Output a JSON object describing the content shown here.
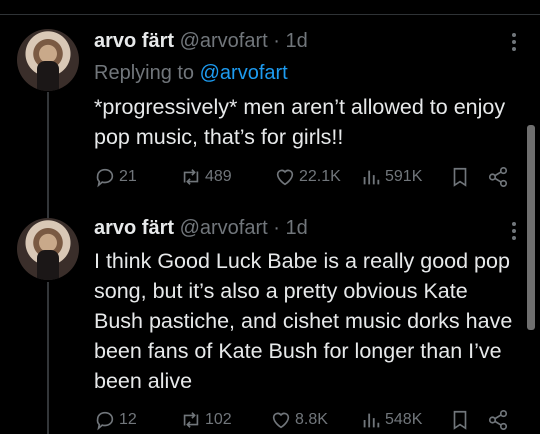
{
  "tweets": [
    {
      "author_name": "arvo färt",
      "handle": "@arvofart",
      "separator": "·",
      "time": "1d",
      "replying_prefix": "Replying to ",
      "replying_to": "@arvofart",
      "text": "*progressively* men aren’t allowed to enjoy pop music, that’s for girls!!",
      "replies": "21",
      "reposts": "489",
      "likes": "22.1K",
      "views": "591K"
    },
    {
      "author_name": "arvo färt",
      "handle": "@arvofart",
      "separator": "·",
      "time": "1d",
      "text": "I think Good Luck Babe is a really good pop song, but it’s also a pretty obvious Kate Bush pastiche, and cishet music dorks have been fans of Kate Bush for longer than I’ve been alive",
      "replies": "12",
      "reposts": "102",
      "likes": "8.8K",
      "views": "548K"
    }
  ],
  "colors": {
    "background": "#000000",
    "text": "#e7e9ea",
    "muted": "#71767b",
    "link": "#1d9bf0"
  },
  "icons": [
    "reply-icon",
    "repost-icon",
    "like-icon",
    "views-icon",
    "bookmark-icon",
    "share-icon",
    "more-icon"
  ]
}
